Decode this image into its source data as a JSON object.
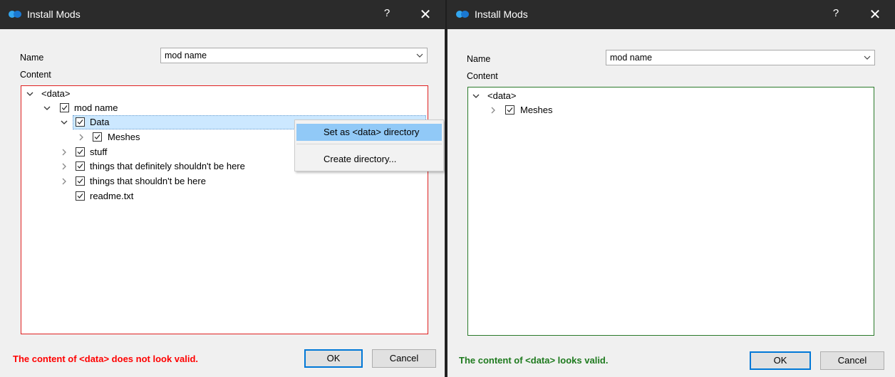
{
  "dialogs": [
    {
      "title": "Install Mods",
      "help": "?",
      "close": "✕",
      "name_label": "Name",
      "name_value": "mod name",
      "content_label": "Content",
      "status": "The content of <data> does not look valid.",
      "status_color": "#ff0000",
      "tree_border_color": "#e02020",
      "ok": "OK",
      "cancel": "Cancel",
      "tree": [
        {
          "label": "<data>",
          "expander": "expanded",
          "checkbox": false
        },
        {
          "label": "mod name",
          "expander": "expanded",
          "checkbox": true
        },
        {
          "label": "Data",
          "expander": "expanded",
          "checkbox": true,
          "selected": true
        },
        {
          "label": "Meshes",
          "expander": "collapsed",
          "checkbox": true
        },
        {
          "label": "stuff",
          "expander": "collapsed",
          "checkbox": true
        },
        {
          "label": "things that definitely shouldn't be here",
          "expander": "collapsed",
          "checkbox": true
        },
        {
          "label": "things that shouldn't be here",
          "expander": "collapsed",
          "checkbox": true
        },
        {
          "label": "readme.txt",
          "expander": "none",
          "checkbox": true
        }
      ],
      "context_menu": [
        "Set as <data> directory",
        "Create directory..."
      ]
    },
    {
      "title": "Install Mods",
      "help": "?",
      "close": "✕",
      "name_label": "Name",
      "name_value": "mod name",
      "content_label": "Content",
      "status": "The content of <data> looks valid.",
      "status_color": "#1e7a1e",
      "tree_border_color": "#2a7a2a",
      "ok": "OK",
      "cancel": "Cancel",
      "tree": [
        {
          "label": "<data>",
          "expander": "expanded",
          "checkbox": false
        },
        {
          "label": "Meshes",
          "expander": "collapsed",
          "checkbox": true
        }
      ]
    }
  ]
}
